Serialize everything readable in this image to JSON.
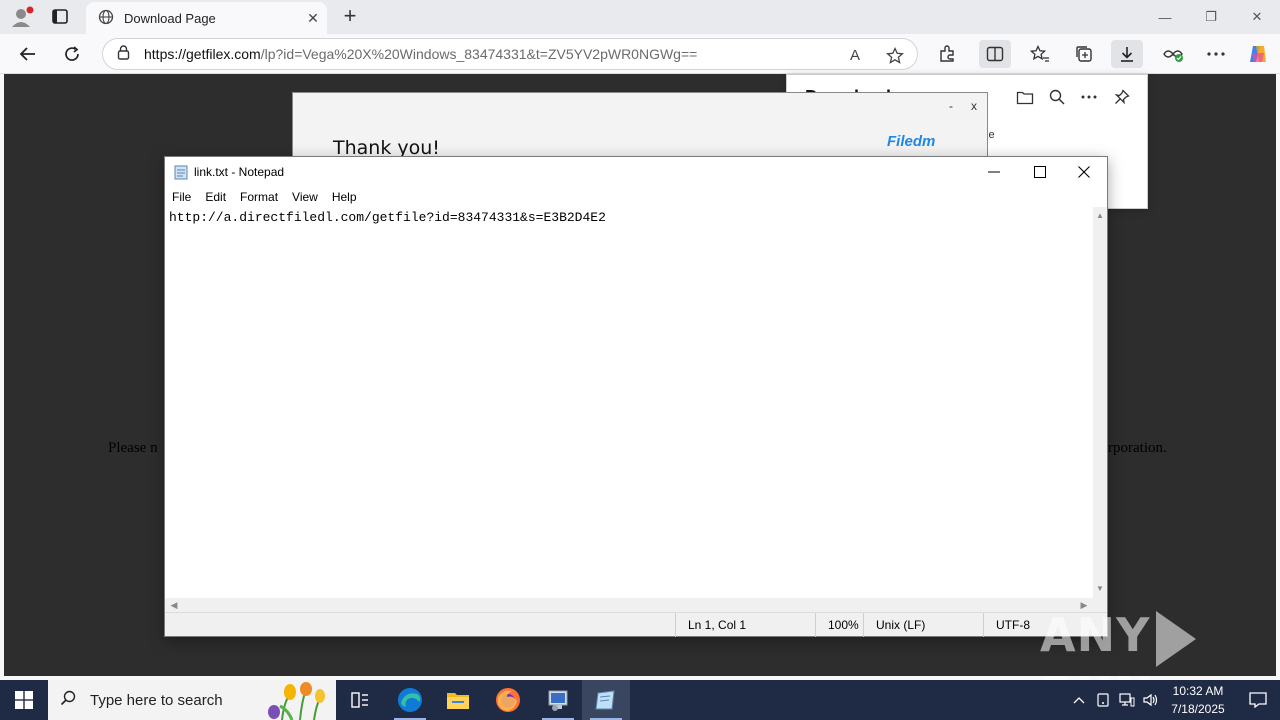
{
  "browser": {
    "tab_title": "Download Page",
    "tab_close": "✕",
    "new_tab": "+",
    "url_host": "https://getfilex.com",
    "url_rest": "/lp?id=Vega%20X%20Windows_83474331&t=ZV5YV2pWR0NGWg==",
    "read_aloud": "A",
    "window_min": "—",
    "window_restore": "❐",
    "window_close": "✕"
  },
  "page": {
    "note_left": "Please n",
    "note_right": "rporation."
  },
  "popup": {
    "thanks": "Thank you!",
    "brand": "Filedm",
    "minimize": "-",
    "close": "x"
  },
  "downloads": {
    "title": "Downloads",
    "file_fragment": "xe"
  },
  "notepad": {
    "title": "link.txt - Notepad",
    "menu": [
      "File",
      "Edit",
      "Format",
      "View",
      "Help"
    ],
    "content": "http://a.directfiledl.com/getfile?id=83474331&s=E3B2D4E2",
    "status": {
      "position": "Ln 1, Col 1",
      "zoom": "100%",
      "line_ending": "Unix (LF)",
      "encoding": "UTF-8"
    }
  },
  "watermark": {
    "left": "ANY",
    "right": "RUN"
  },
  "taskbar": {
    "search_placeholder": "Type here to search",
    "time": "10:32 AM",
    "date": "7/18/2025"
  },
  "colors": {
    "accent_blue": "#1e88e5",
    "taskbar_bg": "#1f2a44",
    "page_bg": "#2d2d2d"
  }
}
